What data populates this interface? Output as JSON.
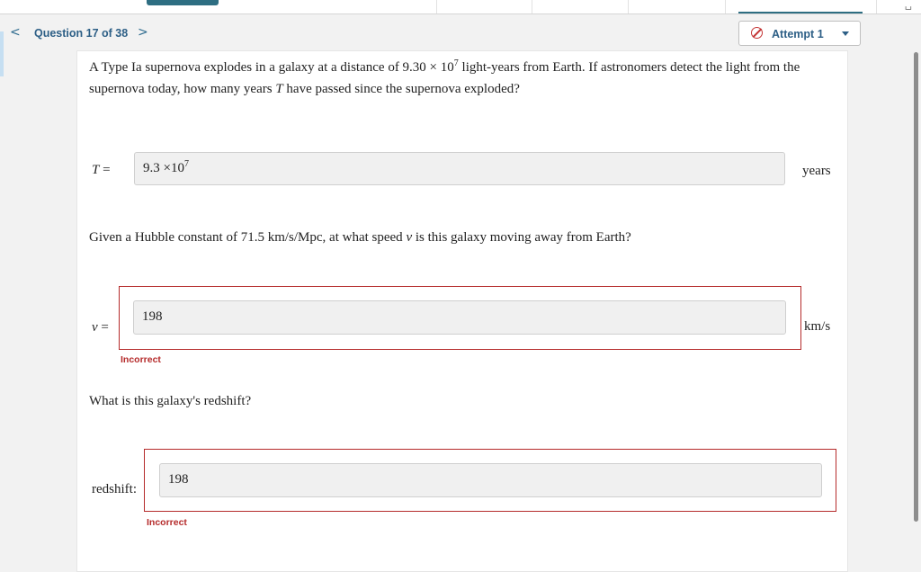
{
  "nav": {
    "prev": "<",
    "next": ">",
    "question_counter": "Question 17 of 38",
    "attempt_label": "Attempt 1"
  },
  "question": {
    "part1_text_a": "A Type Ia supernova explodes in a galaxy at a distance of 9.30 × 10",
    "part1_exp": "7",
    "part1_text_b": " light-years from Earth. If astronomers detect the light from the supernova today, how many years ",
    "part1_var": "T",
    "part1_text_c": " have passed since the supernova exploded?",
    "part2_text_a": "Given a Hubble constant of 71.5 km/s/Mpc, at what speed ",
    "part2_var": "v",
    "part2_text_b": " is this galaxy moving away from Earth?",
    "part3_text": "What is this galaxy's redshift?"
  },
  "answers": {
    "T_label": "T",
    "T_equals": " =",
    "T_value": "9.3  ×10",
    "T_exp": "7",
    "T_unit": "years",
    "v_label": "v",
    "v_equals": " =",
    "v_value": "198",
    "v_unit": "km/s",
    "v_status": "Incorrect",
    "z_label": "redshift:",
    "z_value": "198",
    "z_status": "Incorrect"
  },
  "colors": {
    "accent": "#2d5f86",
    "error": "#b52b2b"
  }
}
